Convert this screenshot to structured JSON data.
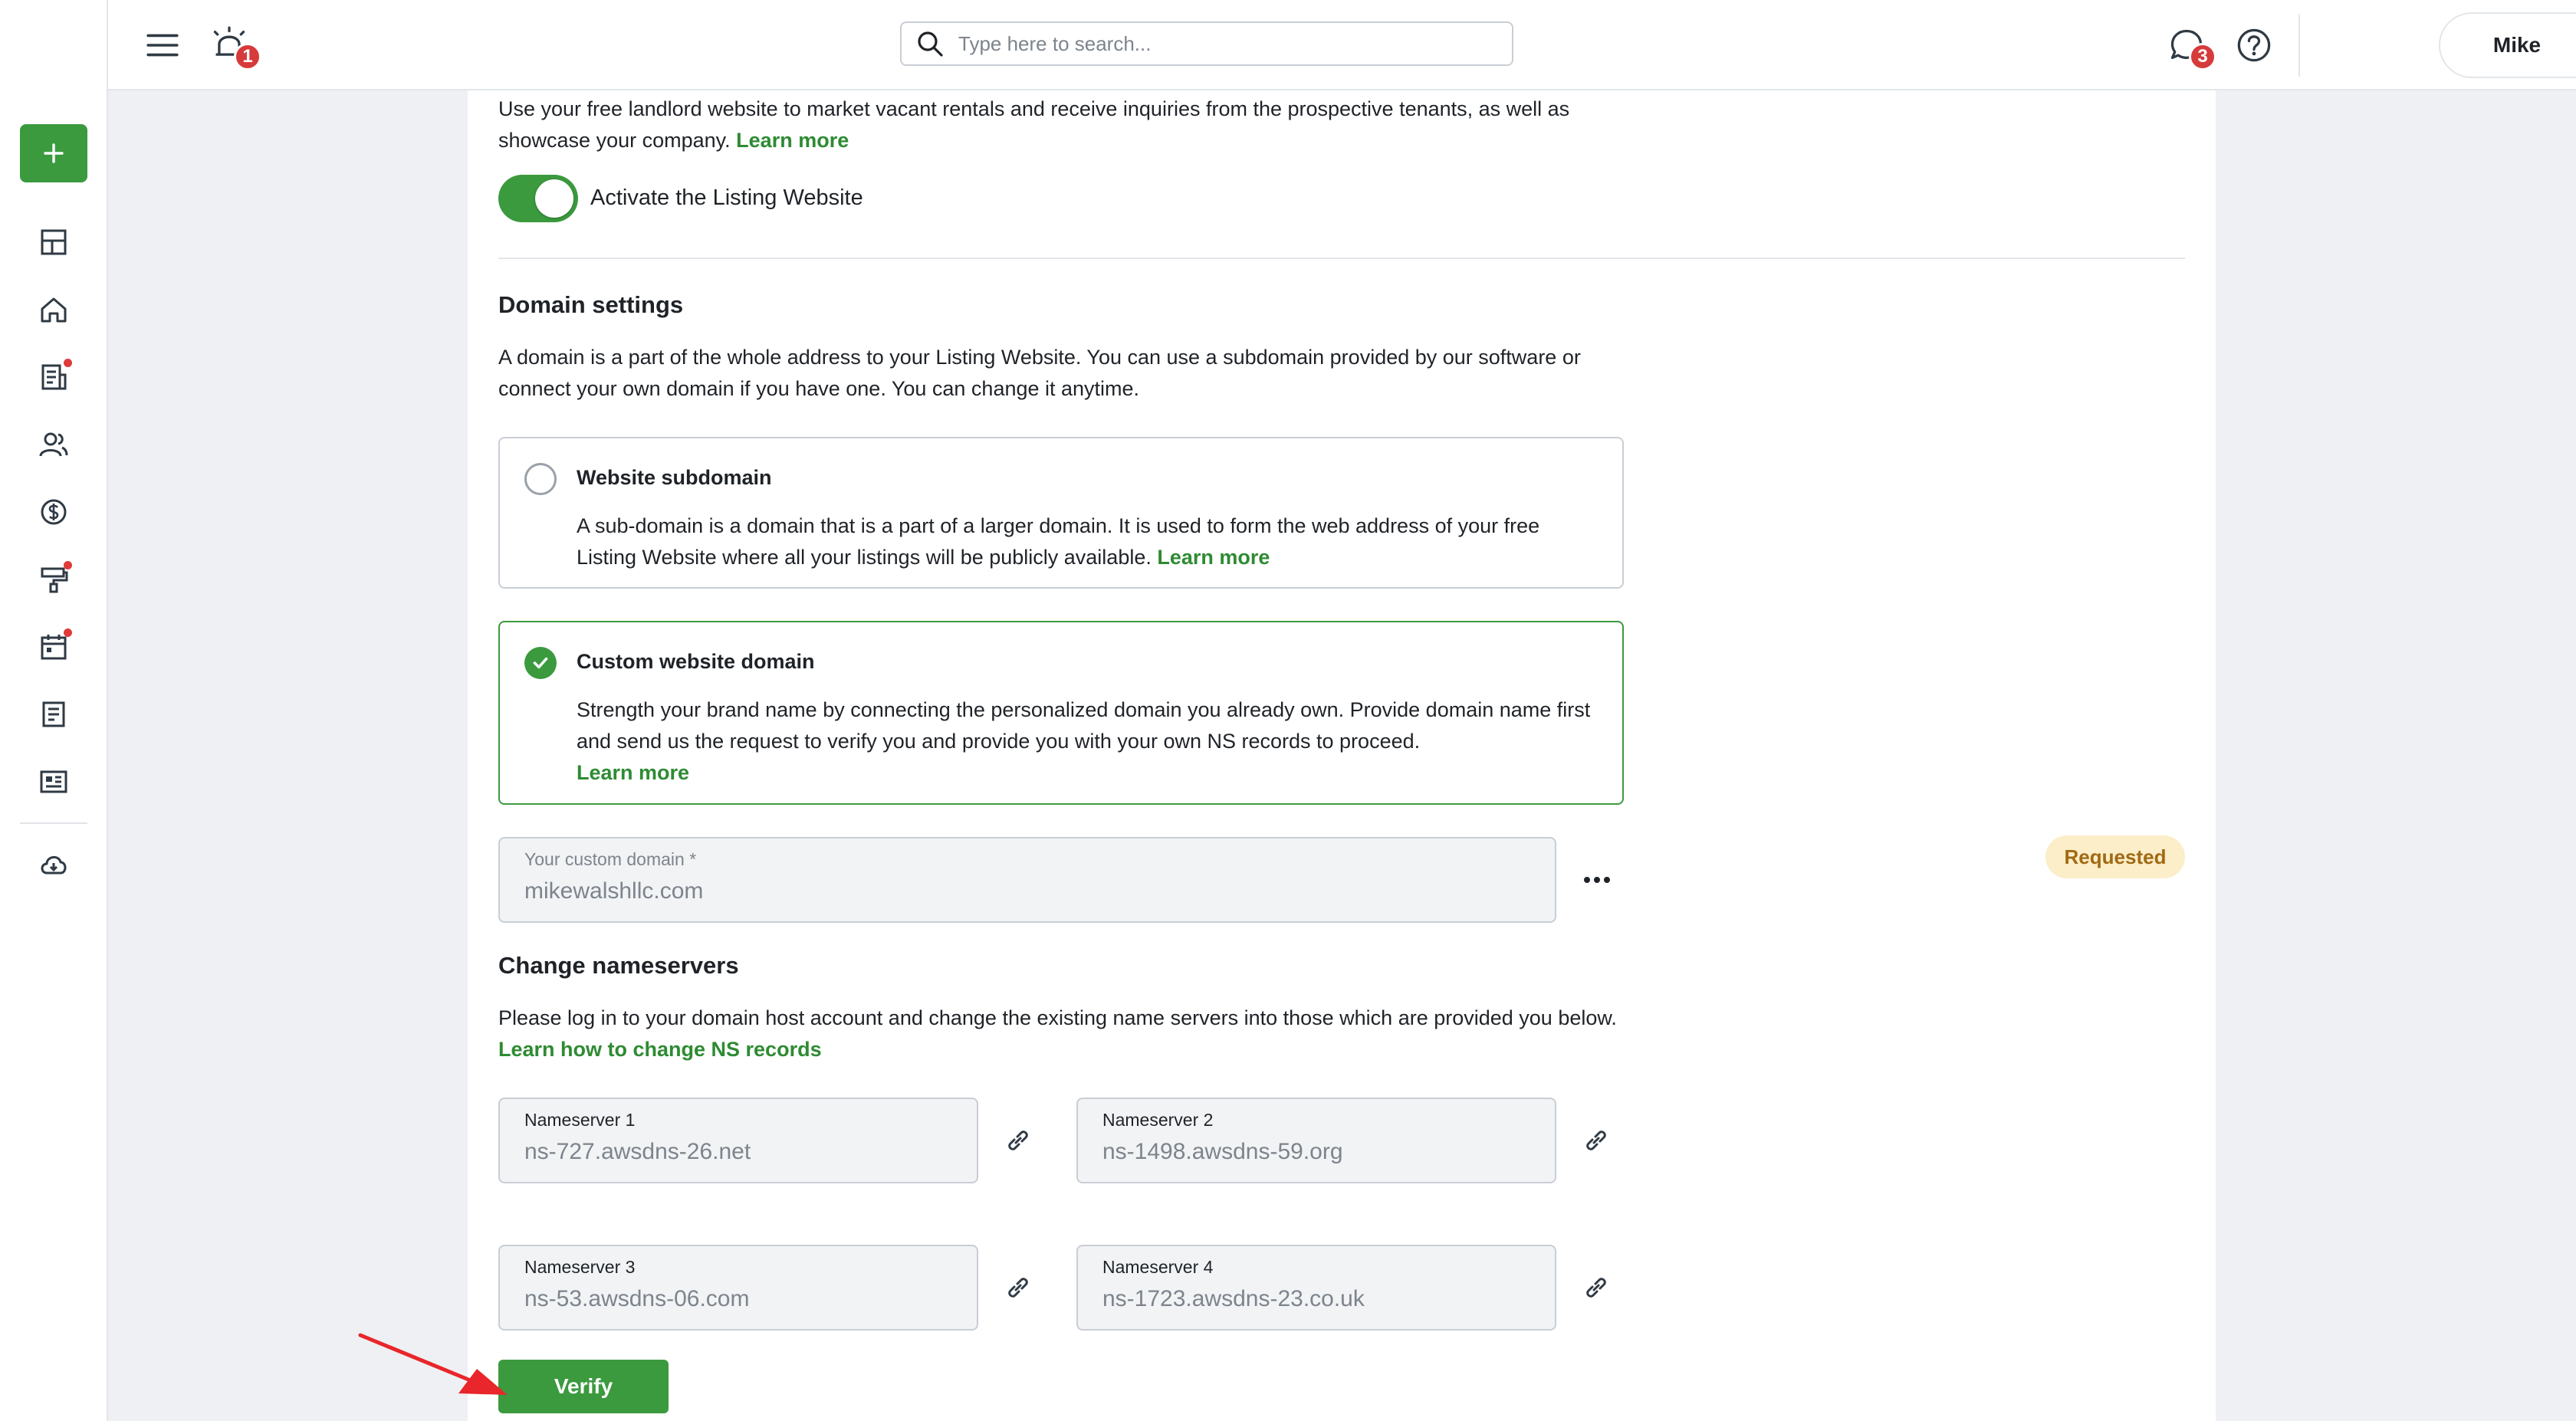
{
  "header": {
    "search_placeholder": "Type here to search...",
    "alerts_badge": "1",
    "messages_badge": "3",
    "user_name": "Mike"
  },
  "sidebar": {
    "icons": [
      {
        "name": "dashboard-icon",
        "dot": false
      },
      {
        "name": "home-icon",
        "dot": false
      },
      {
        "name": "leases-icon",
        "dot": true
      },
      {
        "name": "people-icon",
        "dot": false
      },
      {
        "name": "accounting-icon",
        "dot": false
      },
      {
        "name": "maintenance-icon",
        "dot": true
      },
      {
        "name": "calendar-icon",
        "dot": true
      },
      {
        "name": "documents-icon",
        "dot": false
      },
      {
        "name": "reports-icon",
        "dot": false
      },
      {
        "name": "download-icon",
        "dot": false
      }
    ]
  },
  "listing": {
    "intro": "Use your free landlord website to market vacant rentals and receive inquiries from the prospective tenants, as well as showcase your company.",
    "intro_link": "Learn more",
    "toggle_label": "Activate the Listing Website",
    "toggle_on": true
  },
  "domain": {
    "title": "Domain settings",
    "description": "A domain is a part of the whole address to your Listing Website. You can use a subdomain provided by our software or connect your own domain if you have one. You can change it anytime.",
    "options": [
      {
        "title": "Website subdomain",
        "description": "A sub-domain is a domain that is a part of a larger domain. It is used to form the web address of your free Listing Website where all your listings will be publicly available.",
        "link": "Learn more",
        "selected": false
      },
      {
        "title": "Custom website domain",
        "description": "Strength your brand name by connecting the personalized domain you already own. Provide domain name first and send us the request to verify you and provide you with your own NS records to proceed.",
        "link": "Learn more",
        "selected": true
      }
    ],
    "custom_domain_label": "Your custom domain *",
    "custom_domain_value": "mikewalshllc.com",
    "status": "Requested",
    "status_color": "#fbeec8"
  },
  "nameservers": {
    "title": "Change nameservers",
    "description": "Please log in to your domain host account and change the existing name servers into those which are provided you below.",
    "link": "Learn how to change NS records",
    "items": [
      {
        "label": "Nameserver 1",
        "value": "ns-727.awsdns-26.net"
      },
      {
        "label": "Nameserver 2",
        "value": "ns-1498.awsdns-59.org"
      },
      {
        "label": "Nameserver 3",
        "value": "ns-53.awsdns-06.com"
      },
      {
        "label": "Nameserver 4",
        "value": "ns-1723.awsdns-23.co.uk"
      }
    ],
    "verify_label": "Verify"
  },
  "colors": {
    "accent": "#3b9a3e",
    "link": "#2e8b32",
    "badge": "#d73a3a",
    "annotation_arrow": "#e8262b"
  }
}
